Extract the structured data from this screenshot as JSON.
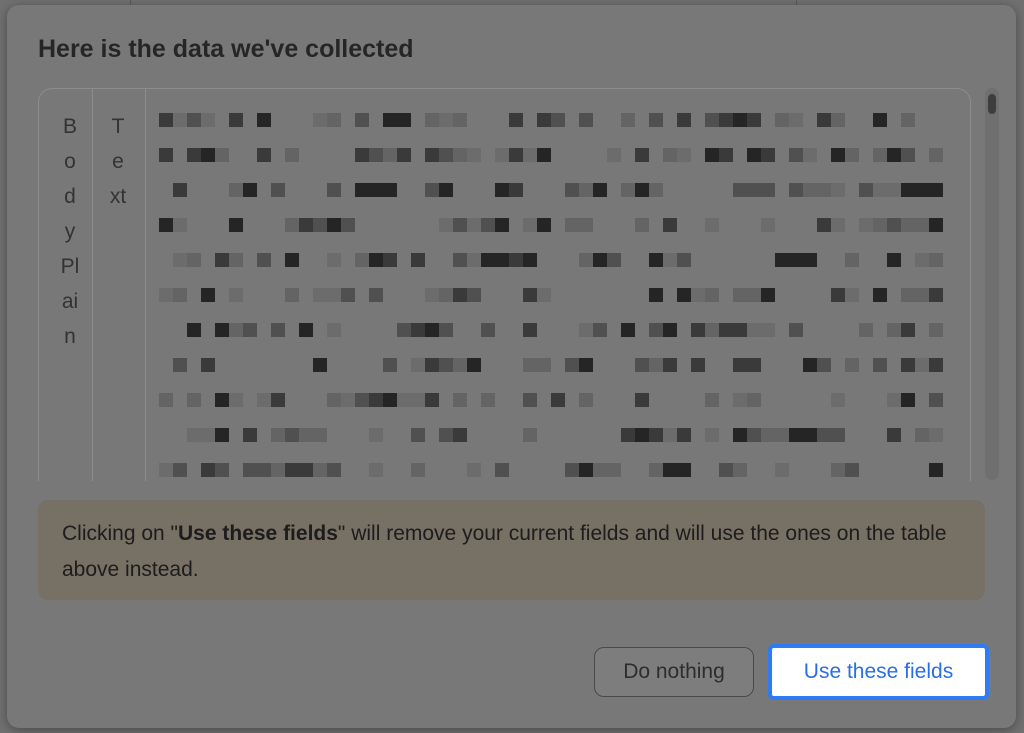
{
  "modal": {
    "title": "Here is the data we've collected"
  },
  "table": {
    "column_1_chars": [
      "B",
      "o",
      "d",
      "y",
      "Pl",
      "ai",
      "n"
    ],
    "column_2_chars": [
      "T",
      "e",
      "xt"
    ],
    "content_state": "pixelated"
  },
  "notice": {
    "prefix": "Clicking on \"",
    "emphasis": "Use these fields",
    "suffix": "\" will remove your current fields and will use the ones on the table above instead."
  },
  "buttons": {
    "do_nothing_label": "Do nothing",
    "use_fields_label": "Use these fields"
  },
  "colors": {
    "accent": "#2e7bf6",
    "notice_bg": "#777064",
    "overlay": "#707070"
  }
}
